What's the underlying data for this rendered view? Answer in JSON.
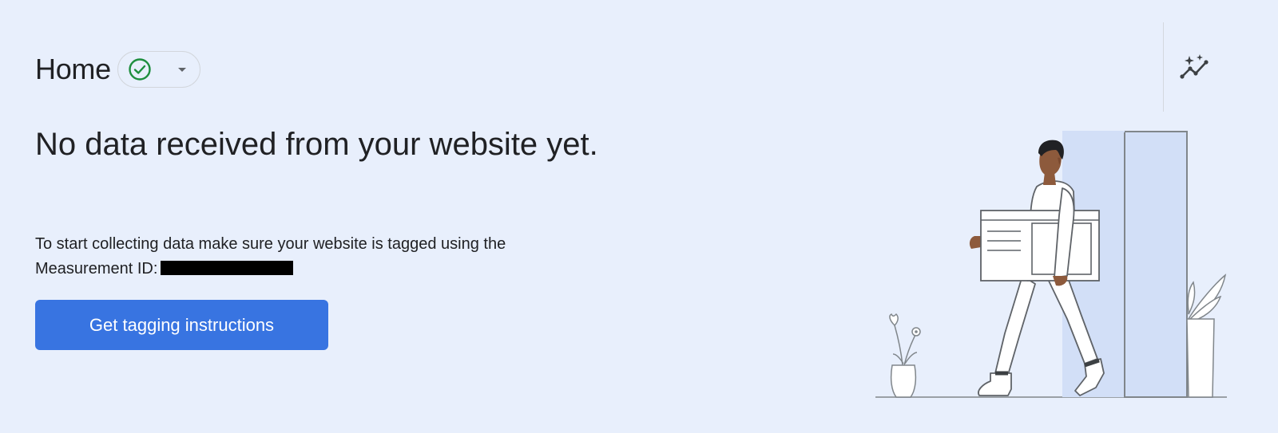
{
  "header": {
    "title": "Home",
    "status_icon": "check-circle-icon",
    "dropdown_icon": "arrow-drop-down-icon",
    "status_color": "#1e8e3e"
  },
  "toolbar": {
    "insights_icon": "insights-sparkle-icon"
  },
  "main": {
    "headline": "No data received from your website yet.",
    "description_prefix": "To start collecting data make sure your website is tagged using the Measurement ID:",
    "measurement_id_redacted": true,
    "primary_button_label": "Get tagging instructions",
    "primary_button_color": "#3874e1"
  },
  "illustration": {
    "name": "person-carrying-browser-window-illustration"
  }
}
